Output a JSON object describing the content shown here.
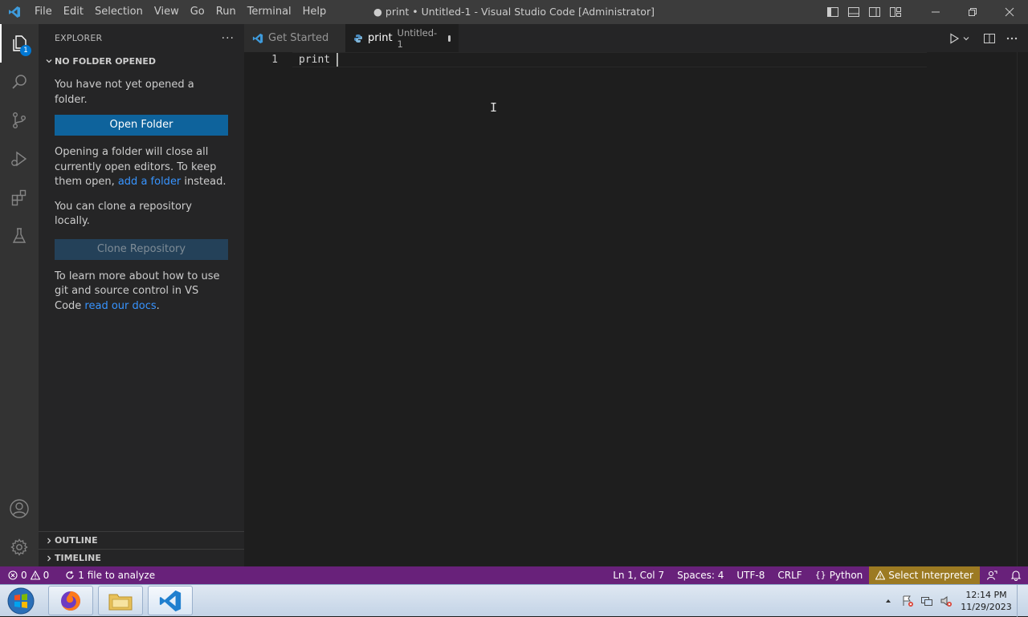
{
  "window": {
    "title": "● print • Untitled-1 - Visual Studio Code [Administrator]"
  },
  "menu": [
    "File",
    "Edit",
    "Selection",
    "View",
    "Go",
    "Run",
    "Terminal",
    "Help"
  ],
  "activity_bar": {
    "explorer_badge": "1",
    "items": [
      "explorer-icon",
      "search-icon",
      "source-control-icon",
      "run-debug-icon",
      "extensions-icon",
      "testing-icon",
      "accounts-icon",
      "settings-gear-icon"
    ]
  },
  "sidebar": {
    "title": "EXPLORER",
    "more": "···",
    "section_title": "NO FOLDER OPENED",
    "intro": "You have not yet opened a folder.",
    "open_folder_button": "Open Folder",
    "warning_part1": "Opening a folder will close all currently open editors. To keep them open, ",
    "warning_link": "add a folder",
    "warning_part2": " instead.",
    "clone_text": "You can clone a repository locally.",
    "clone_button": "Clone Repository",
    "learn_part1": "To learn more about how to use git and source control in VS Code ",
    "learn_link": "read our docs",
    "learn_part2": ".",
    "outline": "OUTLINE",
    "timeline": "TIMELINE"
  },
  "tabs": [
    {
      "label": "Get Started",
      "active": false
    },
    {
      "label": "print",
      "description": "Untitled-1",
      "active": true,
      "dirty": true
    }
  ],
  "editor": {
    "line_number": "1",
    "code": "print "
  },
  "statusbar": {
    "errors": "0",
    "warnings": "0",
    "analyze": "1 file to analyze",
    "position": "Ln 1, Col 7",
    "spaces": "Spaces: 4",
    "encoding": "UTF-8",
    "eol": "CRLF",
    "language": "Python",
    "interpreter": "Select Interpreter"
  },
  "taskbar": {
    "time": "12:14 PM",
    "date": "11/29/2023"
  },
  "colors": {
    "accent": "#0e639c",
    "statusbar": "#68217a",
    "link": "#3794ff"
  }
}
